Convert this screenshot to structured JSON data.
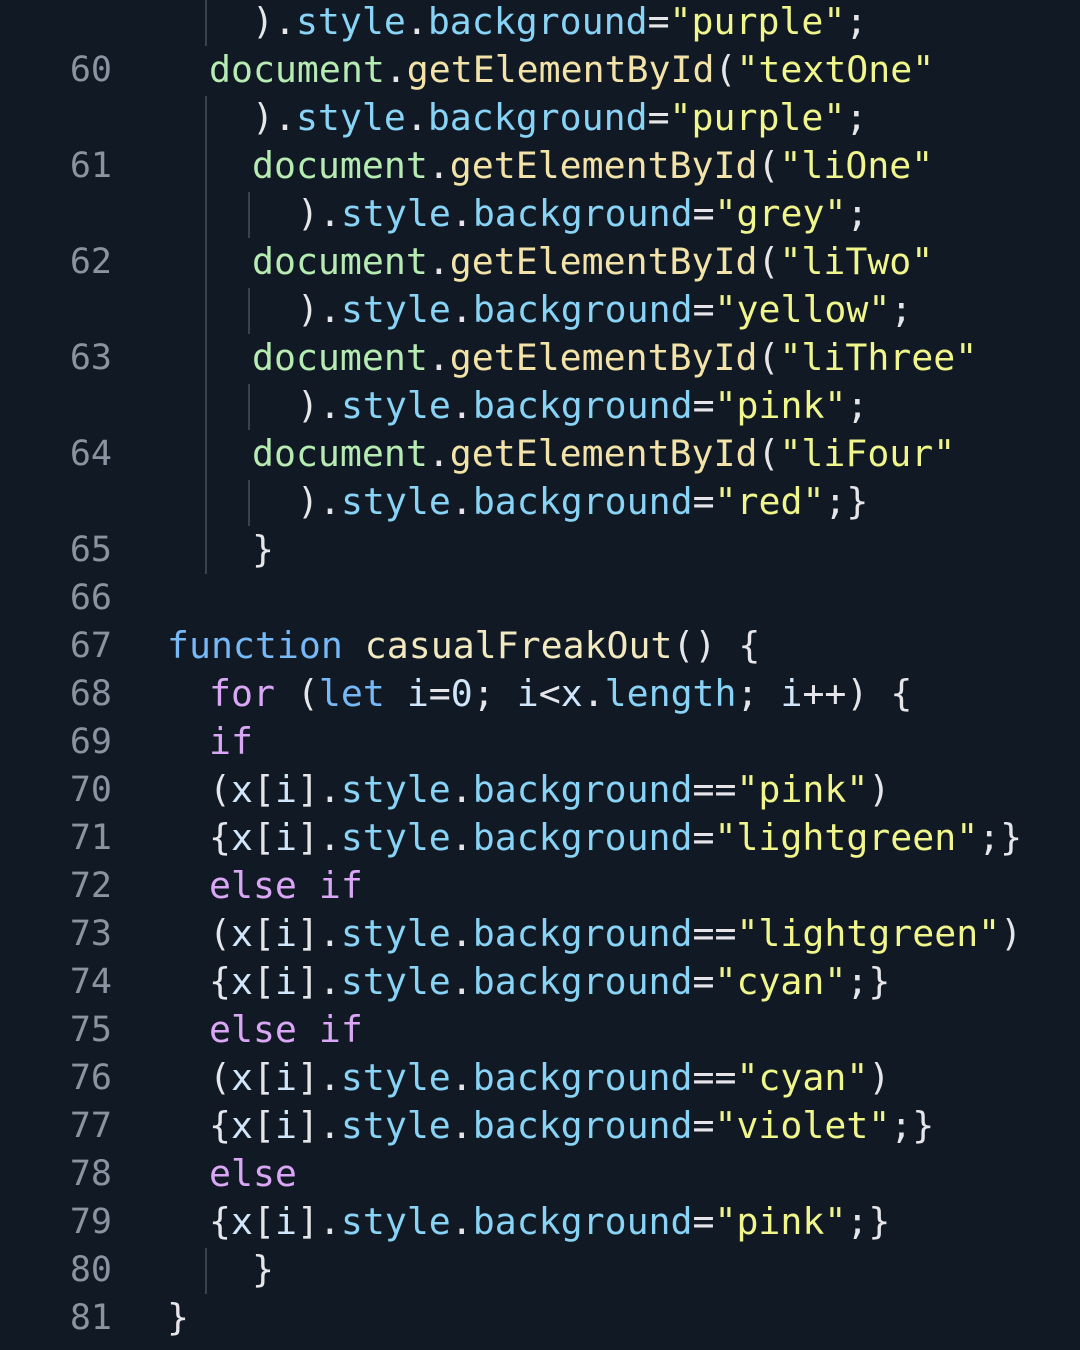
{
  "lines": [
    {
      "num": "",
      "indent": 0,
      "tokens": [
        {
          "t": ").",
          "c": "pun"
        },
        {
          "t": "style",
          "c": "prop"
        },
        {
          "t": ".",
          "c": "pun"
        },
        {
          "t": "background",
          "c": "prop"
        },
        {
          "t": "=",
          "c": "pun"
        },
        {
          "t": "\"purple\"",
          "c": "str"
        },
        {
          "t": ";",
          "c": "pun"
        }
      ]
    },
    {
      "num": "60",
      "indent": 1,
      "tokens": [
        {
          "t": "document",
          "c": "obj"
        },
        {
          "t": ".",
          "c": "pun"
        },
        {
          "t": "getElementById",
          "c": "meth"
        },
        {
          "t": "(",
          "c": "pun"
        },
        {
          "t": "\"textOne\"",
          "c": "str"
        }
      ]
    },
    {
      "num": "",
      "indent": 0,
      "tokens": [
        {
          "t": ").",
          "c": "pun"
        },
        {
          "t": "style",
          "c": "prop"
        },
        {
          "t": ".",
          "c": "pun"
        },
        {
          "t": "background",
          "c": "prop"
        },
        {
          "t": "=",
          "c": "pun"
        },
        {
          "t": "\"purple\"",
          "c": "str"
        },
        {
          "t": ";",
          "c": "pun"
        }
      ]
    },
    {
      "num": "61",
      "indent": 0,
      "tokens": [
        {
          "t": "document",
          "c": "obj"
        },
        {
          "t": ".",
          "c": "pun"
        },
        {
          "t": "getElementById",
          "c": "meth"
        },
        {
          "t": "(",
          "c": "pun"
        },
        {
          "t": "\"liOne\"",
          "c": "str"
        }
      ]
    },
    {
      "num": "",
      "indent": 1,
      "tokens": [
        {
          "t": ").",
          "c": "pun"
        },
        {
          "t": "style",
          "c": "prop"
        },
        {
          "t": ".",
          "c": "pun"
        },
        {
          "t": "background",
          "c": "prop"
        },
        {
          "t": "=",
          "c": "pun"
        },
        {
          "t": "\"grey\"",
          "c": "str"
        },
        {
          "t": ";",
          "c": "pun"
        }
      ]
    },
    {
      "num": "62",
      "indent": 0,
      "tokens": [
        {
          "t": "document",
          "c": "obj"
        },
        {
          "t": ".",
          "c": "pun"
        },
        {
          "t": "getElementById",
          "c": "meth"
        },
        {
          "t": "(",
          "c": "pun"
        },
        {
          "t": "\"liTwo\"",
          "c": "str"
        }
      ]
    },
    {
      "num": "",
      "indent": 1,
      "tokens": [
        {
          "t": ").",
          "c": "pun"
        },
        {
          "t": "style",
          "c": "prop"
        },
        {
          "t": ".",
          "c": "pun"
        },
        {
          "t": "background",
          "c": "prop"
        },
        {
          "t": "=",
          "c": "pun"
        },
        {
          "t": "\"yellow\"",
          "c": "str"
        },
        {
          "t": ";",
          "c": "pun"
        }
      ]
    },
    {
      "num": "63",
      "indent": 0,
      "tokens": [
        {
          "t": "document",
          "c": "obj"
        },
        {
          "t": ".",
          "c": "pun"
        },
        {
          "t": "getElementById",
          "c": "meth"
        },
        {
          "t": "(",
          "c": "pun"
        },
        {
          "t": "\"liThree\"",
          "c": "str"
        }
      ]
    },
    {
      "num": "",
      "indent": 1,
      "tokens": [
        {
          "t": ").",
          "c": "pun"
        },
        {
          "t": "style",
          "c": "prop"
        },
        {
          "t": ".",
          "c": "pun"
        },
        {
          "t": "background",
          "c": "prop"
        },
        {
          "t": "=",
          "c": "pun"
        },
        {
          "t": "\"pink\"",
          "c": "str"
        },
        {
          "t": ";",
          "c": "pun"
        }
      ]
    },
    {
      "num": "64",
      "indent": 0,
      "tokens": [
        {
          "t": "document",
          "c": "obj"
        },
        {
          "t": ".",
          "c": "pun"
        },
        {
          "t": "getElementById",
          "c": "meth"
        },
        {
          "t": "(",
          "c": "pun"
        },
        {
          "t": "\"liFour\"",
          "c": "str"
        }
      ]
    },
    {
      "num": "",
      "indent": 1,
      "tokens": [
        {
          "t": ").",
          "c": "pun"
        },
        {
          "t": "style",
          "c": "prop"
        },
        {
          "t": ".",
          "c": "pun"
        },
        {
          "t": "background",
          "c": "prop"
        },
        {
          "t": "=",
          "c": "pun"
        },
        {
          "t": "\"red\"",
          "c": "str"
        },
        {
          "t": ";}",
          "c": "pun"
        }
      ]
    },
    {
      "num": "65",
      "indent": 0,
      "tokens": [
        {
          "t": "}",
          "c": "pun"
        }
      ]
    },
    {
      "num": "66",
      "indent": 0,
      "tokens": []
    },
    {
      "num": "67",
      "indent": 0,
      "tokens": [
        {
          "t": "function",
          "c": "dkw"
        },
        {
          "t": " ",
          "c": "pun"
        },
        {
          "t": "casualFreakOut",
          "c": "fn"
        },
        {
          "t": "() {",
          "c": "pun"
        }
      ]
    },
    {
      "num": "68",
      "indent": 0,
      "tokens": [
        {
          "t": "for",
          "c": "kw"
        },
        {
          "t": " (",
          "c": "pun"
        },
        {
          "t": "let",
          "c": "dkw"
        },
        {
          "t": " ",
          "c": "pun"
        },
        {
          "t": "i",
          "c": "var"
        },
        {
          "t": "=",
          "c": "pun"
        },
        {
          "t": "0",
          "c": "num"
        },
        {
          "t": "; ",
          "c": "pun"
        },
        {
          "t": "i",
          "c": "var"
        },
        {
          "t": "<",
          "c": "pun"
        },
        {
          "t": "x",
          "c": "var"
        },
        {
          "t": ".",
          "c": "pun"
        },
        {
          "t": "length",
          "c": "prop"
        },
        {
          "t": "; ",
          "c": "pun"
        },
        {
          "t": "i",
          "c": "var"
        },
        {
          "t": "++) {",
          "c": "pun"
        }
      ]
    },
    {
      "num": "69",
      "indent": 0,
      "tokens": [
        {
          "t": "if",
          "c": "kw"
        }
      ]
    },
    {
      "num": "70",
      "indent": 0,
      "tokens": [
        {
          "t": "(",
          "c": "pun"
        },
        {
          "t": "x",
          "c": "var"
        },
        {
          "t": "[",
          "c": "pun"
        },
        {
          "t": "i",
          "c": "var"
        },
        {
          "t": "].",
          "c": "pun"
        },
        {
          "t": "style",
          "c": "prop"
        },
        {
          "t": ".",
          "c": "pun"
        },
        {
          "t": "background",
          "c": "prop"
        },
        {
          "t": "==",
          "c": "pun"
        },
        {
          "t": "\"pink\"",
          "c": "str"
        },
        {
          "t": ")",
          "c": "pun"
        }
      ]
    },
    {
      "num": "71",
      "indent": 0,
      "tokens": [
        {
          "t": "{",
          "c": "pun"
        },
        {
          "t": "x",
          "c": "var"
        },
        {
          "t": "[",
          "c": "pun"
        },
        {
          "t": "i",
          "c": "var"
        },
        {
          "t": "].",
          "c": "pun"
        },
        {
          "t": "style",
          "c": "prop"
        },
        {
          "t": ".",
          "c": "pun"
        },
        {
          "t": "background",
          "c": "prop"
        },
        {
          "t": "=",
          "c": "pun"
        },
        {
          "t": "\"lightgreen\"",
          "c": "str"
        },
        {
          "t": ";}",
          "c": "pun"
        }
      ]
    },
    {
      "num": "72",
      "indent": 0,
      "tokens": [
        {
          "t": "else",
          "c": "kw"
        },
        {
          "t": " ",
          "c": "pun"
        },
        {
          "t": "if",
          "c": "kw"
        }
      ]
    },
    {
      "num": "73",
      "indent": 0,
      "tokens": [
        {
          "t": "(",
          "c": "pun"
        },
        {
          "t": "x",
          "c": "var"
        },
        {
          "t": "[",
          "c": "pun"
        },
        {
          "t": "i",
          "c": "var"
        },
        {
          "t": "].",
          "c": "pun"
        },
        {
          "t": "style",
          "c": "prop"
        },
        {
          "t": ".",
          "c": "pun"
        },
        {
          "t": "background",
          "c": "prop"
        },
        {
          "t": "==",
          "c": "pun"
        },
        {
          "t": "\"lightgreen\"",
          "c": "str"
        },
        {
          "t": ")",
          "c": "pun"
        }
      ]
    },
    {
      "num": "74",
      "indent": 0,
      "tokens": [
        {
          "t": "{",
          "c": "pun"
        },
        {
          "t": "x",
          "c": "var"
        },
        {
          "t": "[",
          "c": "pun"
        },
        {
          "t": "i",
          "c": "var"
        },
        {
          "t": "].",
          "c": "pun"
        },
        {
          "t": "style",
          "c": "prop"
        },
        {
          "t": ".",
          "c": "pun"
        },
        {
          "t": "background",
          "c": "prop"
        },
        {
          "t": "=",
          "c": "pun"
        },
        {
          "t": "\"cyan\"",
          "c": "str"
        },
        {
          "t": ";}",
          "c": "pun"
        }
      ]
    },
    {
      "num": "75",
      "indent": 0,
      "tokens": [
        {
          "t": "else",
          "c": "kw"
        },
        {
          "t": " ",
          "c": "pun"
        },
        {
          "t": "if",
          "c": "kw"
        }
      ]
    },
    {
      "num": "76",
      "indent": 0,
      "tokens": [
        {
          "t": "(",
          "c": "pun"
        },
        {
          "t": "x",
          "c": "var"
        },
        {
          "t": "[",
          "c": "pun"
        },
        {
          "t": "i",
          "c": "var"
        },
        {
          "t": "].",
          "c": "pun"
        },
        {
          "t": "style",
          "c": "prop"
        },
        {
          "t": ".",
          "c": "pun"
        },
        {
          "t": "background",
          "c": "prop"
        },
        {
          "t": "==",
          "c": "pun"
        },
        {
          "t": "\"cyan\"",
          "c": "str"
        },
        {
          "t": ")",
          "c": "pun"
        }
      ]
    },
    {
      "num": "77",
      "indent": 0,
      "tokens": [
        {
          "t": "{",
          "c": "pun"
        },
        {
          "t": "x",
          "c": "var"
        },
        {
          "t": "[",
          "c": "pun"
        },
        {
          "t": "i",
          "c": "var"
        },
        {
          "t": "].",
          "c": "pun"
        },
        {
          "t": "style",
          "c": "prop"
        },
        {
          "t": ".",
          "c": "pun"
        },
        {
          "t": "background",
          "c": "prop"
        },
        {
          "t": "=",
          "c": "pun"
        },
        {
          "t": "\"violet\"",
          "c": "str"
        },
        {
          "t": ";}",
          "c": "pun"
        }
      ]
    },
    {
      "num": "78",
      "indent": 0,
      "tokens": [
        {
          "t": "else",
          "c": "kw"
        }
      ]
    },
    {
      "num": "79",
      "indent": 0,
      "tokens": [
        {
          "t": "{",
          "c": "pun"
        },
        {
          "t": "x",
          "c": "var"
        },
        {
          "t": "[",
          "c": "pun"
        },
        {
          "t": "i",
          "c": "var"
        },
        {
          "t": "].",
          "c": "pun"
        },
        {
          "t": "style",
          "c": "prop"
        },
        {
          "t": ".",
          "c": "pun"
        },
        {
          "t": "background",
          "c": "prop"
        },
        {
          "t": "=",
          "c": "pun"
        },
        {
          "t": "\"pink\"",
          "c": "str"
        },
        {
          "t": ";}",
          "c": "pun"
        }
      ]
    },
    {
      "num": "80",
      "indent": 0,
      "tokens": [
        {
          "t": "}",
          "c": "pun"
        }
      ]
    },
    {
      "num": "81",
      "indent": 0,
      "tokens": [
        {
          "t": "}",
          "c": "pun"
        }
      ]
    }
  ],
  "colors": {
    "background": "#111a24",
    "line_number": "#8b93a1",
    "object": "#b6ecb3",
    "property": "#89d3f6",
    "method": "#f4e3a9",
    "string": "#f0f58c",
    "keyword": "#d9a7f5",
    "declaration_keyword": "#77b8f7",
    "function_name": "#f3e9c0",
    "punctuation": "#e6e6ea"
  }
}
